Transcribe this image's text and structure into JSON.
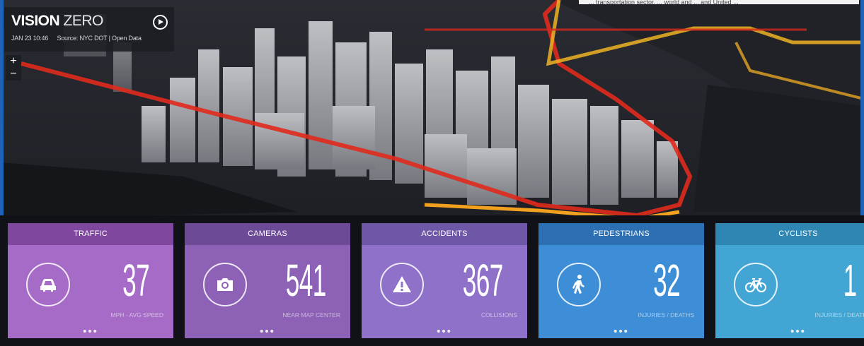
{
  "brand": {
    "title_bold": "VISION",
    "title_light": "ZERO",
    "timestamp": "JAN 23 10:46",
    "source": "Source: NYC DOT | Open Data"
  },
  "top_banner": "... transportation sector, ... world and ... and United ...",
  "zoom": {
    "in": "+",
    "out": "−"
  },
  "cards": [
    {
      "title": "TRAFFIC",
      "value": "37",
      "label": "MPH - AVG SPEED",
      "icon": "car-icon",
      "color": "#a66bc7",
      "head_color": "#80479f"
    },
    {
      "title": "CAMERAS",
      "value": "541",
      "label": "NEAR MAP CENTER",
      "icon": "camera-icon",
      "color": "#8c61b6",
      "head_color": "#6c4a95"
    },
    {
      "title": "ACCIDENTS",
      "value": "367",
      "label": "COLLISIONS",
      "icon": "warning-icon",
      "color": "#8f71c9",
      "head_color": "#6e57a7"
    },
    {
      "title": "PEDESTRIANS",
      "value": "32",
      "label": "INJURIES / DEATHS",
      "icon": "pedestrian-icon",
      "color": "#3d8ed6",
      "head_color": "#2c6fb2"
    },
    {
      "title": "CYCLISTS",
      "value": "1",
      "label": "INJURIES / DEATHS",
      "icon": "bicycle-icon",
      "color": "#43a5d4",
      "head_color": "#2f86b3"
    }
  ],
  "more_indicator": "•••"
}
